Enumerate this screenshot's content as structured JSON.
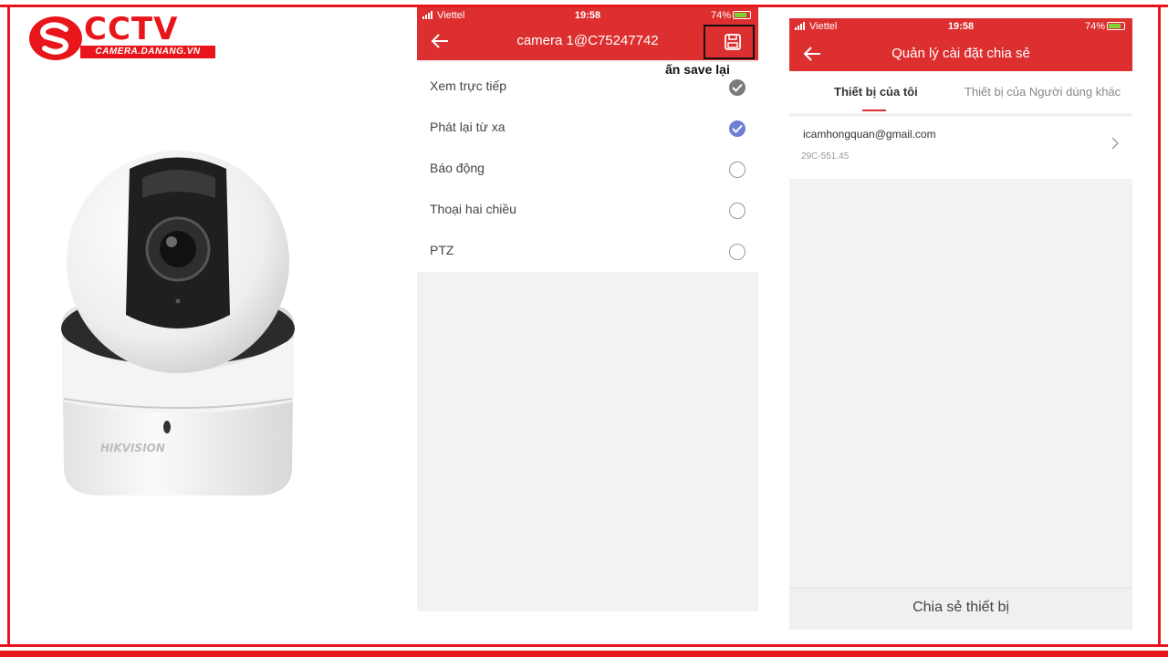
{
  "brand": {
    "name": "CCTV",
    "subtitle": "CAMERA.DANANG.VN",
    "color": "#e8161b"
  },
  "camera_image": {
    "brand_mark": "HIKVISION"
  },
  "phone1": {
    "status": {
      "carrier": "Viettel",
      "time": "19:58",
      "battery": "74%"
    },
    "title": "camera 1@C75247742",
    "hint": "ấn save lại",
    "permissions": [
      {
        "label": "Xem trực tiếp",
        "state": "checked-grey"
      },
      {
        "label": "Phát lại từ xa",
        "state": "checked-blue"
      },
      {
        "label": "Báo động",
        "state": "unchecked"
      },
      {
        "label": "Thoại hai chiều",
        "state": "unchecked"
      },
      {
        "label": "PTZ",
        "state": "unchecked"
      }
    ]
  },
  "phone2": {
    "status": {
      "carrier": "Viettel",
      "time": "19:58",
      "battery": "74%"
    },
    "title": "Quản lý cài đặt chia sẻ",
    "tabs": [
      "Thiết bị của tôi",
      "Thiết bị của Người dùng khác"
    ],
    "active_tab": 0,
    "shared_item": {
      "email": "icamhongquan@gmail.com",
      "device": "29C-551.45"
    },
    "action_label": "Chia sẻ thiết bị"
  },
  "colors": {
    "app_red": "#dd2f2f",
    "check_blue": "#6f7fd6",
    "check_grey": "#7b7b7b"
  }
}
